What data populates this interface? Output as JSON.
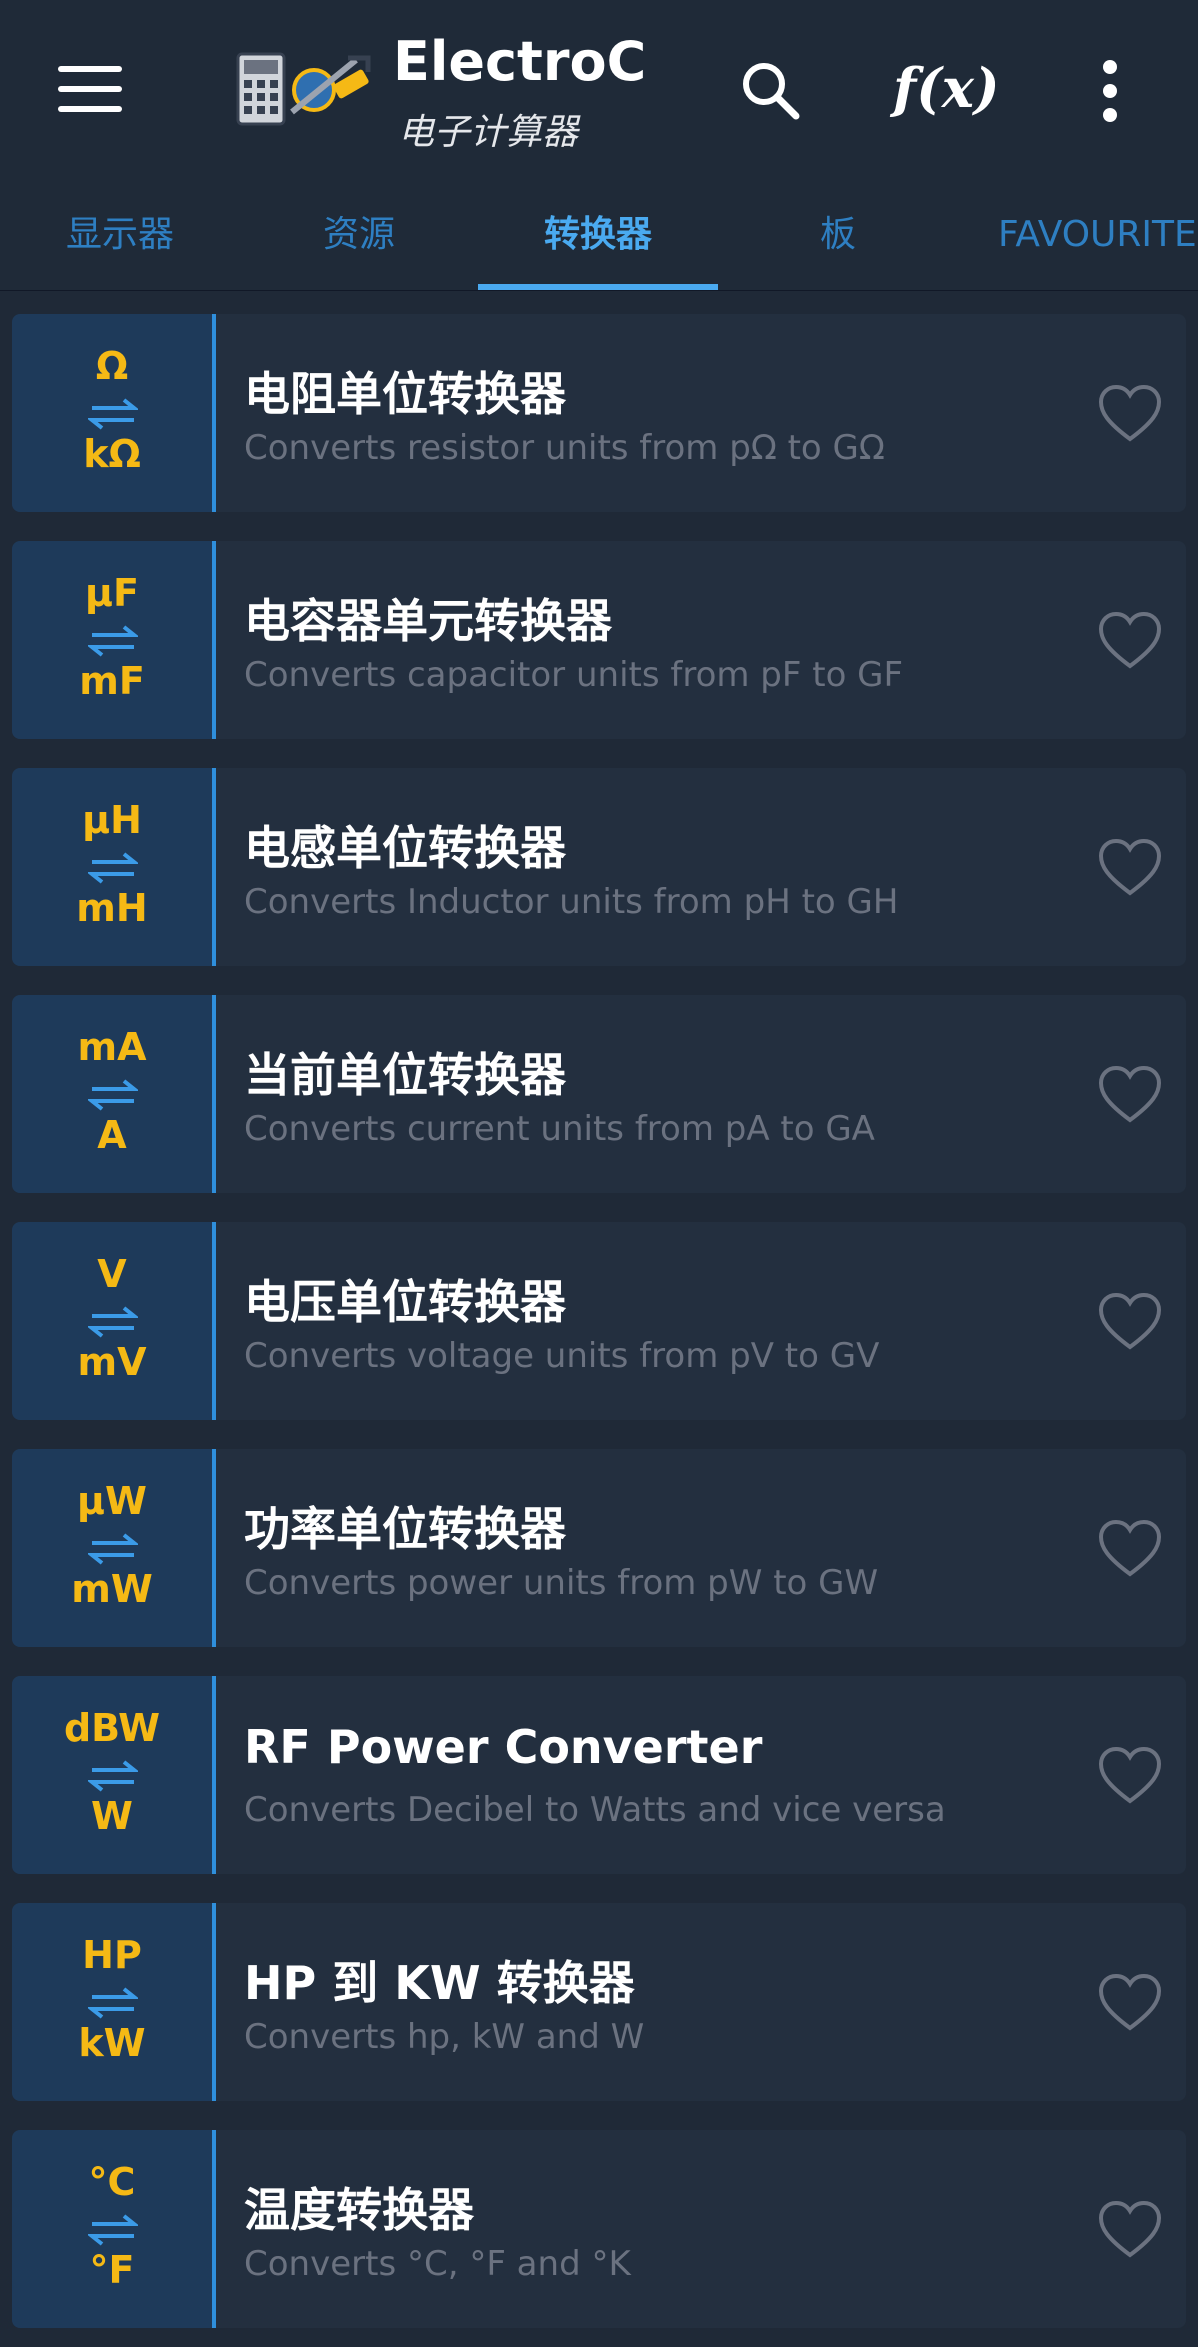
{
  "app": {
    "title": "ElectroC...",
    "subtitle": "电子计算器",
    "fx_label": "f(x)"
  },
  "tabs": [
    {
      "label": "显示器"
    },
    {
      "label": "资源"
    },
    {
      "label": "转换器",
      "active": true
    },
    {
      "label": "板"
    },
    {
      "label": "FAVOURITE"
    }
  ],
  "items": [
    {
      "unit_top": "Ω",
      "unit_bottom": "kΩ",
      "title": "电阻单位转换器",
      "desc": "Converts resistor units from pΩ to GΩ"
    },
    {
      "unit_top": "µF",
      "unit_bottom": "mF",
      "title": "电容器单元转换器",
      "desc": "Converts capacitor units from pF to GF"
    },
    {
      "unit_top": "µH",
      "unit_bottom": "mH",
      "title": "电感单位转换器",
      "desc": "Converts Inductor units from pH to GH"
    },
    {
      "unit_top": "mA",
      "unit_bottom": "A",
      "title": "当前单位转换器",
      "desc": "Converts current units from pA to GA"
    },
    {
      "unit_top": "V",
      "unit_bottom": "mV",
      "title": "电压单位转换器",
      "desc": "Converts voltage units from pV to GV"
    },
    {
      "unit_top": "µW",
      "unit_bottom": "mW",
      "title": "功率单位转换器",
      "desc": "Converts power units from pW to GW"
    },
    {
      "unit_top": "dBW",
      "unit_bottom": "W",
      "title": "RF Power Converter",
      "desc": "Converts Decibel to Watts and vice versa"
    },
    {
      "unit_top": "HP",
      "unit_bottom": "kW",
      "title": "HP 到 KW 转换器",
      "desc": "Converts hp, kW and W"
    },
    {
      "unit_top": "°C",
      "unit_bottom": "°F",
      "title": "温度转换器",
      "desc": "Converts °C, °F and °K"
    }
  ],
  "colors": {
    "background": "#1f2937",
    "accent": "#4aaaf0",
    "unit_text": "#f5b915"
  },
  "icons": {
    "menu": "hamburger-icon",
    "search": "search-icon",
    "more": "more-vertical-icon",
    "swap": "swap-arrows-icon",
    "favourite": "heart-outline-icon"
  }
}
